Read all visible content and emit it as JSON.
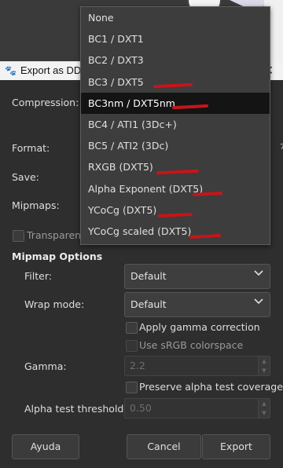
{
  "window": {
    "title": "Export as DDS",
    "close_glyph": "✕"
  },
  "labels": {
    "compression": "Compression:",
    "format": "Format:",
    "save": "Save:",
    "mipmaps": "Mipmaps:",
    "transparent": "Transparent",
    "mipmap_options": "Mipmap Options",
    "filter": "Filter:",
    "wrap_mode": "Wrap mode:",
    "gamma": "Gamma:",
    "alpha_test_threshold": "Alpha test threshold:"
  },
  "filter": {
    "value": "Default"
  },
  "wrap_mode": {
    "value": "Default"
  },
  "checks": {
    "apply_gamma": "Apply gamma correction",
    "use_srgb": "Use sRGB colorspace",
    "preserve_alpha": "Preserve alpha test coverage"
  },
  "gamma": {
    "value": "2.2"
  },
  "alpha_threshold": {
    "value": "0.50"
  },
  "buttons": {
    "help": "Ayuda",
    "cancel": "Cancel",
    "export": "Export"
  },
  "compression_menu": {
    "items": [
      {
        "label": "None"
      },
      {
        "label": "BC1 / DXT1"
      },
      {
        "label": "BC2 / DXT3"
      },
      {
        "label": "BC3 / DXT5"
      },
      {
        "label": "BC3nm / DXT5nm"
      },
      {
        "label": "BC4 / ATI1 (3Dc+)"
      },
      {
        "label": "BC5 / ATI2 (3Dc)"
      },
      {
        "label": "RXGB (DXT5)"
      },
      {
        "label": "Alpha Exponent (DXT5)"
      },
      {
        "label": "YCoCg (DXT5)"
      },
      {
        "label": "YCoCg scaled (DXT5)"
      }
    ],
    "selected": "BC3nm / DXT5nm",
    "annotation_color": "#c8141a"
  },
  "background_peek": "7"
}
